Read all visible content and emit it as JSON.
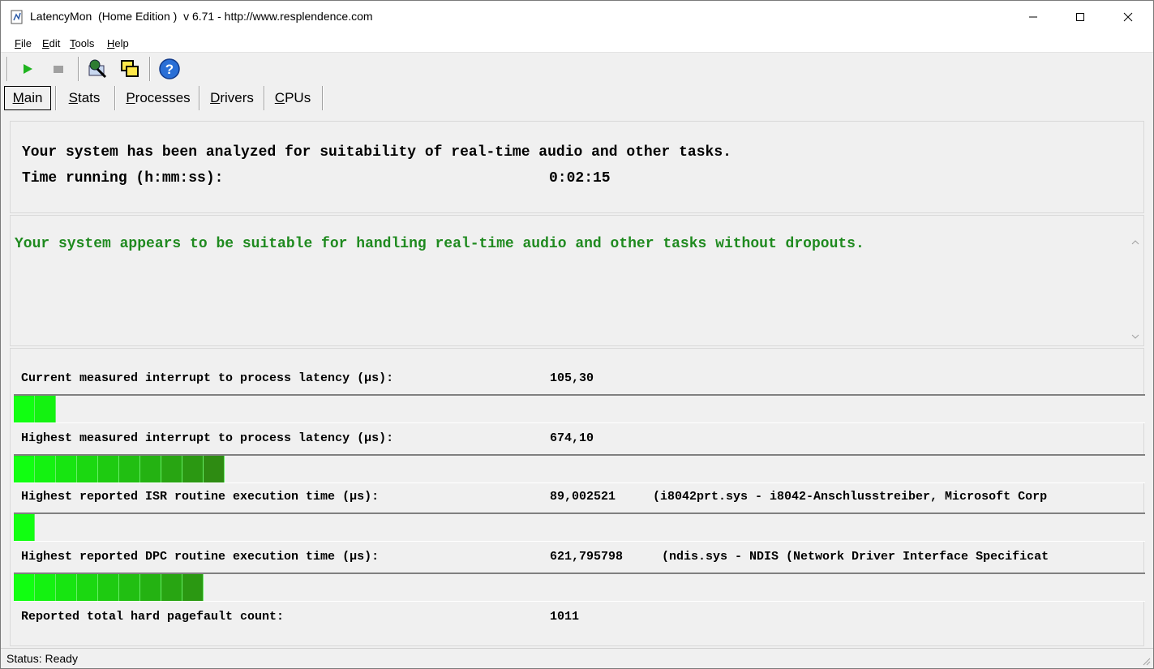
{
  "window": {
    "title": "LatencyMon  (Home Edition )  v 6.71 - http://www.resplendence.com"
  },
  "menu": [
    {
      "accel": "F",
      "rest": "ile"
    },
    {
      "accel": "E",
      "rest": "dit"
    },
    {
      "accel": "T",
      "rest": "ools"
    },
    {
      "accel": "H",
      "rest": "elp"
    }
  ],
  "toolbar": {
    "icons": [
      "play-icon",
      "stop-icon",
      "driver-analysis-icon",
      "copy-windows-icon",
      "help-icon"
    ]
  },
  "tabs": [
    {
      "accel": "M",
      "rest": "ain",
      "active": true
    },
    {
      "accel": "S",
      "rest": "tats",
      "active": false
    },
    {
      "accel": "P",
      "rest": "rocesses",
      "active": false
    },
    {
      "accel": "D",
      "rest": "rivers",
      "active": false
    },
    {
      "accel": "C",
      "rest": "PUs",
      "active": false
    }
  ],
  "summary": {
    "headline": "Your system has been analyzed for suitability of real-time audio and other tasks.",
    "time_label": "Time running (h:mm:ss):",
    "time_value": "0:02:15"
  },
  "verdict": {
    "text": "Your system appears to be suitable for handling real-time audio and other tasks without dropouts.",
    "color": "#1f8a1f"
  },
  "metrics": [
    {
      "label": "Current measured interrupt to process latency (µs):",
      "value": "105,30",
      "detail": "",
      "bar_segments": 2
    },
    {
      "label": "Highest measured interrupt to process latency (µs):",
      "value": "674,10",
      "detail": "",
      "bar_segments": 10
    },
    {
      "label": "Highest reported ISR routine execution time (µs):",
      "value": "89,002521",
      "detail": "(i8042prt.sys - i8042-Anschlusstreiber, Microsoft Corp",
      "bar_segments": 1
    },
    {
      "label": "Highest reported DPC routine execution time (µs):",
      "value": "621,795798",
      "detail": "(ndis.sys - NDIS (Network Driver Interface Specificat",
      "bar_segments": 9
    },
    {
      "label": "Reported total hard pagefault count:",
      "value": "1011",
      "detail": ""
    }
  ],
  "status": {
    "text": "Status: Ready"
  },
  "colors": {
    "bar_bright": "#11ff11",
    "bar_dark": "#2e8b12"
  }
}
